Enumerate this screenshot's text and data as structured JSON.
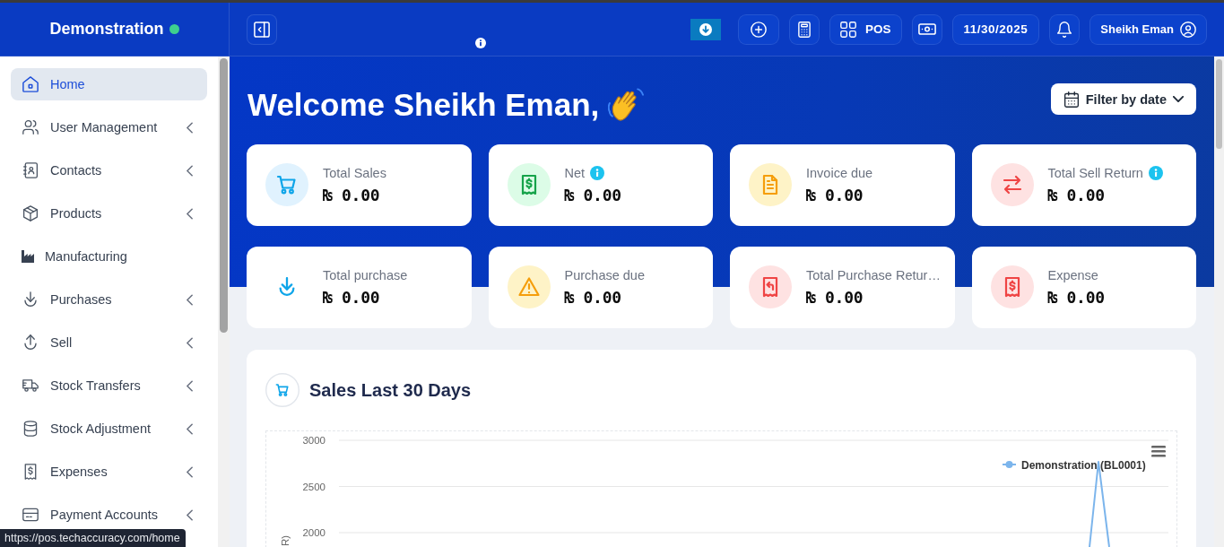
{
  "header": {
    "brand": "Demonstration",
    "online": true,
    "buttons": [
      {
        "kind": "download"
      },
      {
        "kind": "icon"
      },
      {
        "kind": "icon"
      },
      {
        "kind": "icon-label",
        "label": "POS"
      },
      {
        "kind": "icon"
      },
      {
        "kind": "text",
        "label": "11/30/2025"
      },
      {
        "kind": "icon"
      },
      {
        "kind": "label-icon",
        "label": "Sheikh Eman"
      }
    ]
  },
  "sidebar": {
    "items": [
      {
        "label": "Home",
        "selected": true,
        "expandable": false
      },
      {
        "label": "User Management",
        "selected": false,
        "expandable": true
      },
      {
        "label": "Contacts",
        "selected": false,
        "expandable": true
      },
      {
        "label": "Products",
        "selected": false,
        "expandable": true
      },
      {
        "label": "Manufacturing",
        "selected": false,
        "expandable": false
      },
      {
        "label": "Purchases",
        "selected": false,
        "expandable": true
      },
      {
        "label": "Sell",
        "selected": false,
        "expandable": true
      },
      {
        "label": "Stock Transfers",
        "selected": false,
        "expandable": true
      },
      {
        "label": "Stock Adjustment",
        "selected": false,
        "expandable": true
      },
      {
        "label": "Expenses",
        "selected": false,
        "expandable": true
      },
      {
        "label": "Payment Accounts",
        "selected": false,
        "expandable": true
      }
    ]
  },
  "welcome": {
    "title": "Welcome Sheikh Eman,",
    "filter": {
      "label": "Filter by date"
    }
  },
  "cards": [
    {
      "label": "Total Sales",
      "value": "₨ 0.00",
      "color": "#0ea5e9",
      "info": false
    },
    {
      "label": "Net",
      "value": "₨ 0.00",
      "color": "#16a34a",
      "info": true
    },
    {
      "label": "Invoice due",
      "value": "₨ 0.00",
      "color": "#f59e0b",
      "info": false
    },
    {
      "label": "Total Sell Return",
      "value": "₨ 0.00",
      "color": "#ef4444",
      "info": true
    },
    {
      "label": "Total purchase",
      "value": "₨ 0.00",
      "color": "#0ea5e9",
      "info": false
    },
    {
      "label": "Purchase due",
      "value": "₨ 0.00",
      "color": "#f59e0b",
      "info": false
    },
    {
      "label": "Total Purchase Retur…",
      "value": "₨ 0.00",
      "color": "#ef4444",
      "info": false
    },
    {
      "label": "Expense",
      "value": "₨ 0.00",
      "color": "#ef4444",
      "info": false
    }
  ],
  "chart": {
    "title": "Sales Last 30 Days",
    "axis_labels": [
      "3000",
      "2500",
      "2000"
    ],
    "axis_title": "R)",
    "legend": [
      {
        "label": "Demonstration (BL0001)",
        "color": "#7cb5ec"
      }
    ]
  },
  "link_preview": {
    "url": "https://pos.techaccuracy.com/home"
  }
}
